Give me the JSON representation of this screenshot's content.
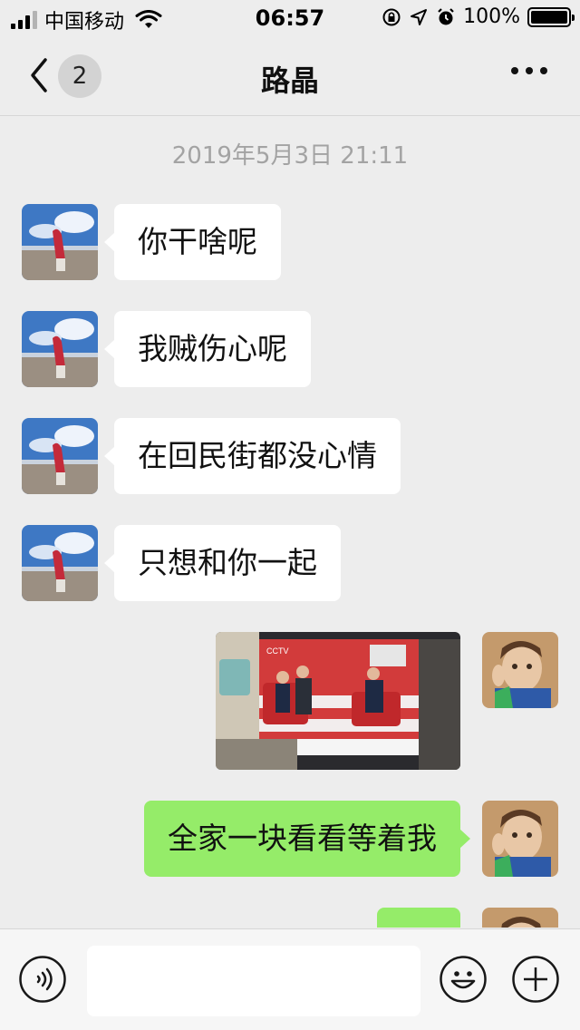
{
  "status_bar": {
    "carrier": "中国移动",
    "time": "06:57",
    "battery_percent": "100%",
    "battery_level": 1.0,
    "icons": [
      "signal-icon",
      "wifi-icon",
      "orientation-lock-icon",
      "location-icon",
      "alarm-icon",
      "battery-icon"
    ]
  },
  "nav": {
    "back_icon": "chevron-left-icon",
    "unread_count": "2",
    "title": "路晶",
    "more_icon": "more-icon"
  },
  "chat": {
    "timestamp": "2019年5月3日 21:11",
    "messages": [
      {
        "from": "friend",
        "type": "text",
        "text": "你干啥呢"
      },
      {
        "from": "friend",
        "type": "text",
        "text": "我贼伤心呢"
      },
      {
        "from": "friend",
        "type": "text",
        "text": "在回民街都没心情"
      },
      {
        "from": "friend",
        "type": "text",
        "text": "只想和你一起"
      },
      {
        "from": "me",
        "type": "image",
        "description": "TV broadcast photo"
      },
      {
        "from": "me",
        "type": "text",
        "text": "全家一块看看等着我"
      },
      {
        "from": "me",
        "type": "text",
        "text": ""
      }
    ]
  },
  "input_bar": {
    "voice_icon": "voice-icon",
    "emoji_icon": "emoji-icon",
    "plus_icon": "plus-icon",
    "input_value": ""
  },
  "colors": {
    "background": "#ededed",
    "incoming_bubble": "#ffffff",
    "outgoing_bubble": "#95ec69",
    "timestamp": "#a3a3a3"
  }
}
